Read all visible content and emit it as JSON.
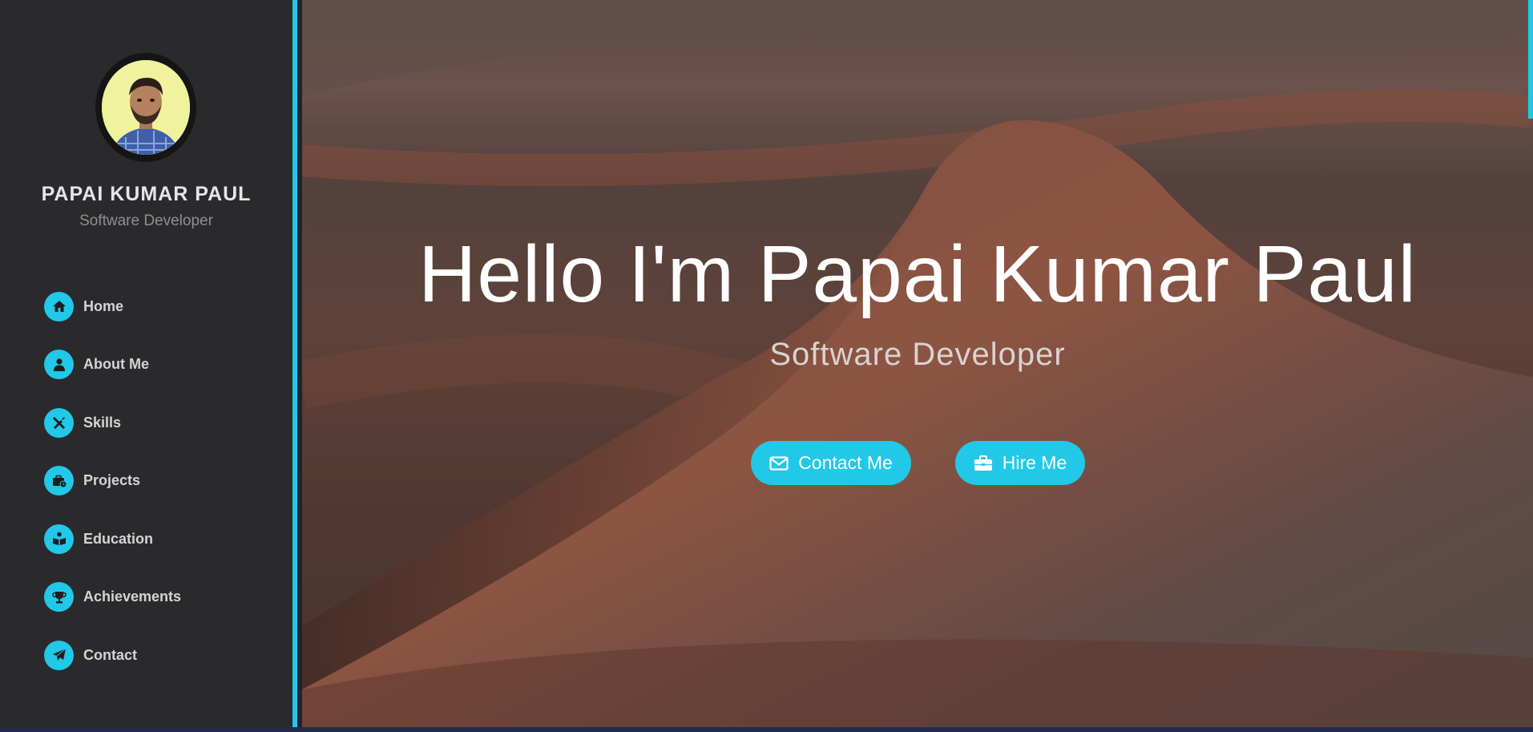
{
  "profile": {
    "name": "PAPAI KUMAR PAUL",
    "role": "Software Developer"
  },
  "nav": {
    "items": [
      {
        "label": "Home",
        "icon": "home-icon"
      },
      {
        "label": "About Me",
        "icon": "user-icon"
      },
      {
        "label": "Skills",
        "icon": "tools-icon"
      },
      {
        "label": "Projects",
        "icon": "briefcase-clock-icon"
      },
      {
        "label": "Education",
        "icon": "book-reader-icon"
      },
      {
        "label": "Achievements",
        "icon": "trophy-icon"
      },
      {
        "label": "Contact",
        "icon": "paper-plane-icon"
      }
    ]
  },
  "hero": {
    "title": "Hello I'm Papai Kumar Paul",
    "subtitle": "Software Developer",
    "contact_label": "Contact Me",
    "hire_label": "Hire Me"
  },
  "colors": {
    "accent": "#22c8e8",
    "sidebar_bg": "#2a2a2c"
  }
}
